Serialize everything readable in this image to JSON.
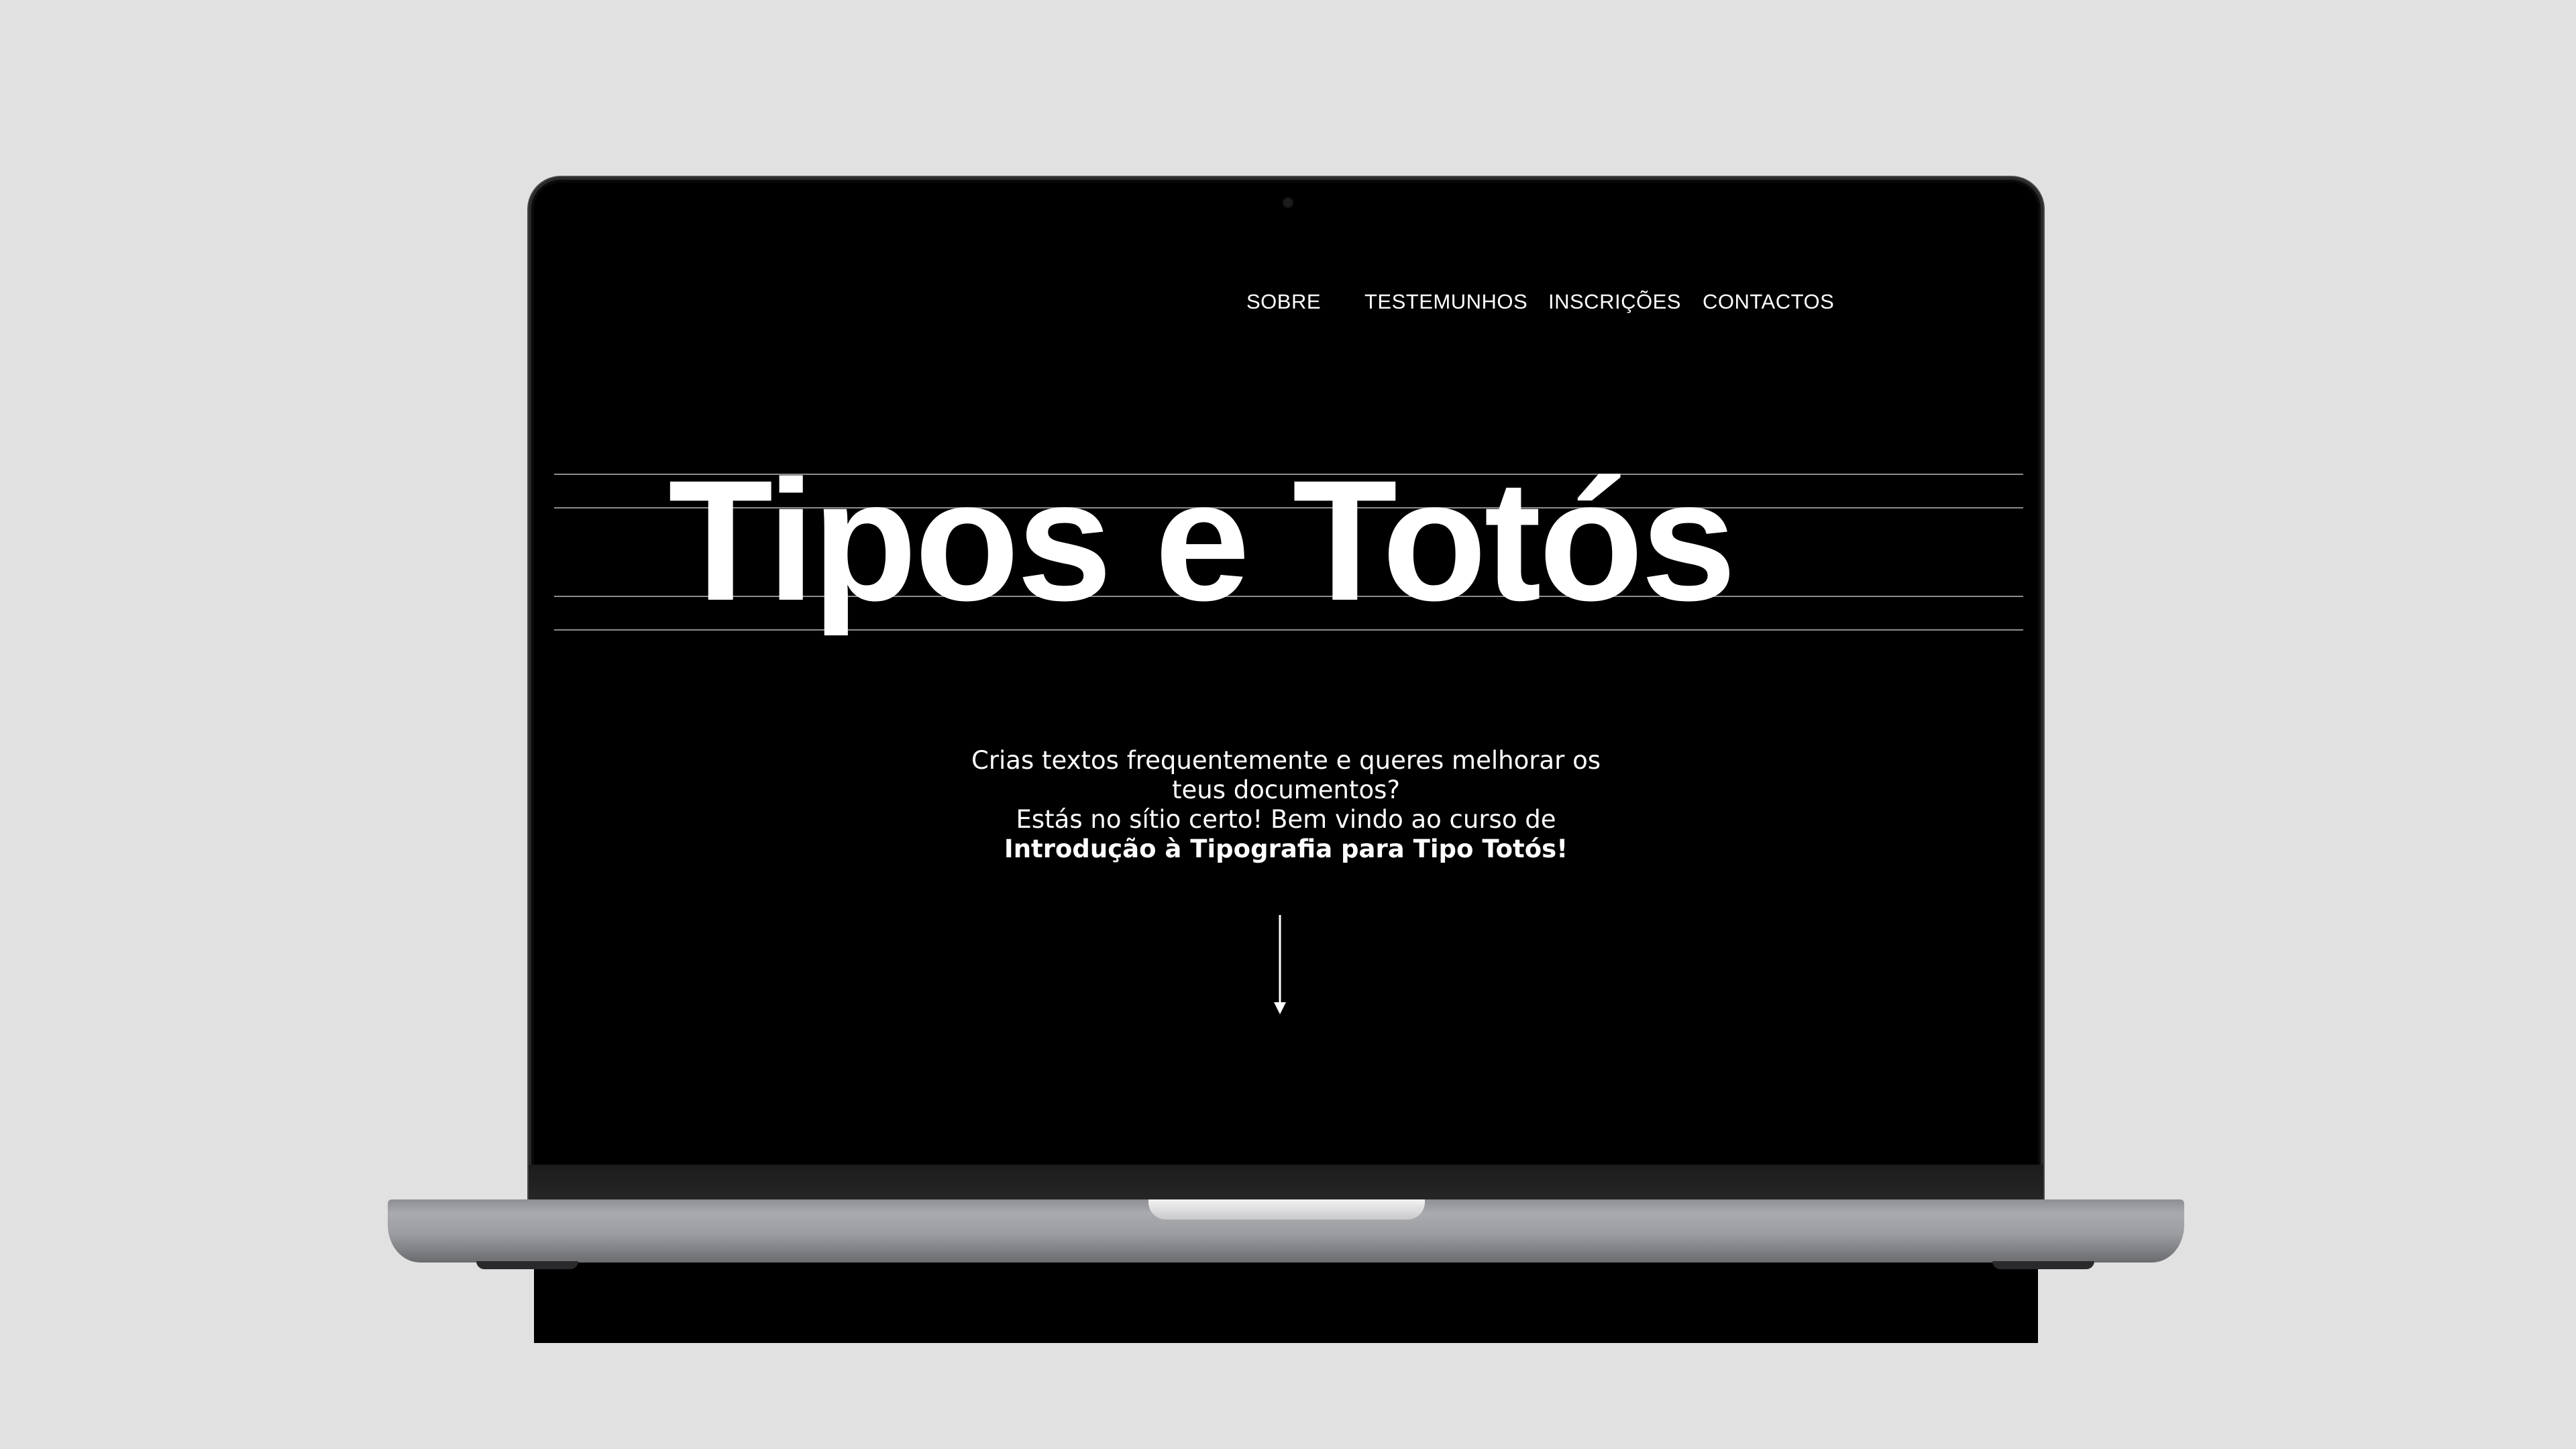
{
  "nav": {
    "items": [
      {
        "label": "SOBRE"
      },
      {
        "label": "TESTEMUNHOS"
      },
      {
        "label": "INSCRIÇÕES"
      },
      {
        "label": "CONTACTOS"
      }
    ]
  },
  "hero": {
    "title": "Tipos e Totós"
  },
  "intro": {
    "line1": "Crias textos frequentemente e queres melhorar os",
    "line2": "teus documentos?",
    "line3": "Estás no sítio certo! Bem vindo ao curso de",
    "line4": "Introdução à Tipografia para Tipo Totós!"
  },
  "icons": {
    "scroll": "arrow-down-icon"
  },
  "colors": {
    "background": "#e1e1e1",
    "screen": "#000000",
    "text": "#ffffff",
    "guides": "#8c8c8c"
  }
}
